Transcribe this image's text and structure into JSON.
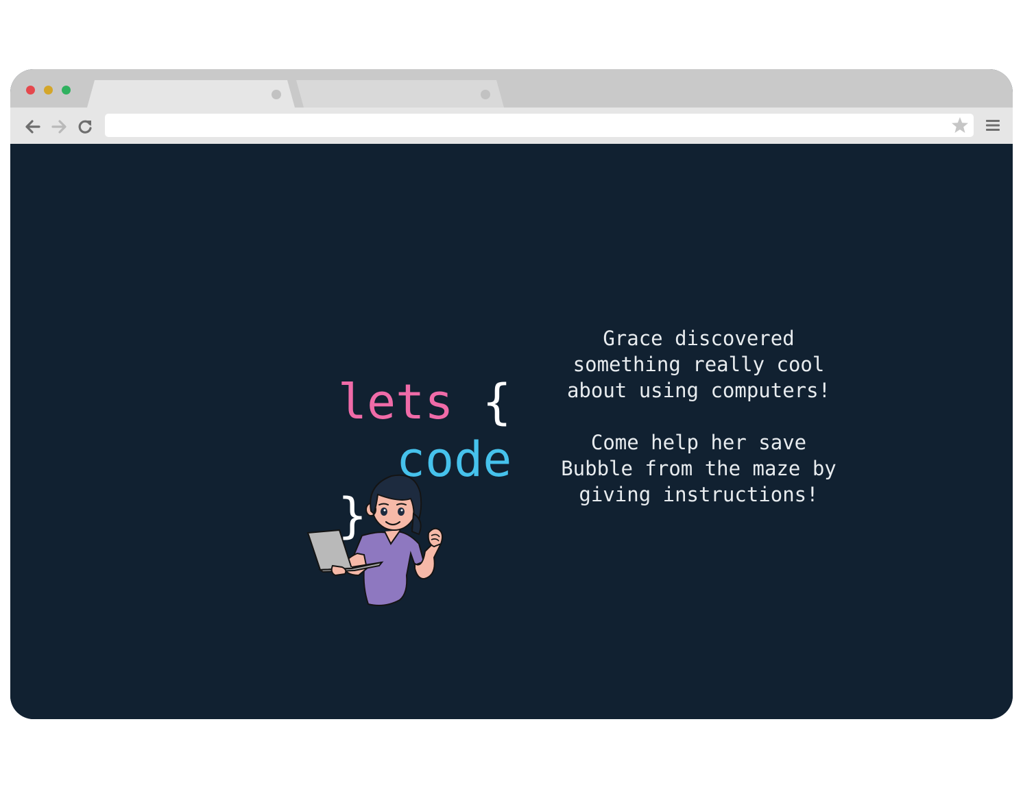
{
  "browser": {
    "window_controls": [
      "close",
      "minimize",
      "maximize"
    ],
    "tabs": [
      {
        "label": "",
        "active": true
      },
      {
        "label": "",
        "active": false
      }
    ],
    "address_bar": {
      "value": ""
    },
    "icons": {
      "back": "arrow-left-icon",
      "forward": "arrow-right-icon",
      "reload": "reload-icon",
      "bookmark": "star-icon",
      "menu": "hamburger-menu-icon"
    }
  },
  "hero": {
    "line1_keyword": "lets",
    "line1_brace": "{",
    "line2_keyword": "code",
    "line3_brace": "}",
    "illustration": "grace-with-laptop"
  },
  "intro": {
    "paragraph1": "Grace discovered\nsomething really cool\nabout using computers!",
    "paragraph2": "Come help her save\nBubble from the maze by\ngiving instructions!"
  },
  "colors": {
    "background": "#112131",
    "keyword_lets": "#f06ba8",
    "keyword_code": "#46c2ec",
    "text": "#e8ecef",
    "close_dot": "#e5484d",
    "minimize_dot": "#d4a62a",
    "maximize_dot": "#2fb15f"
  }
}
